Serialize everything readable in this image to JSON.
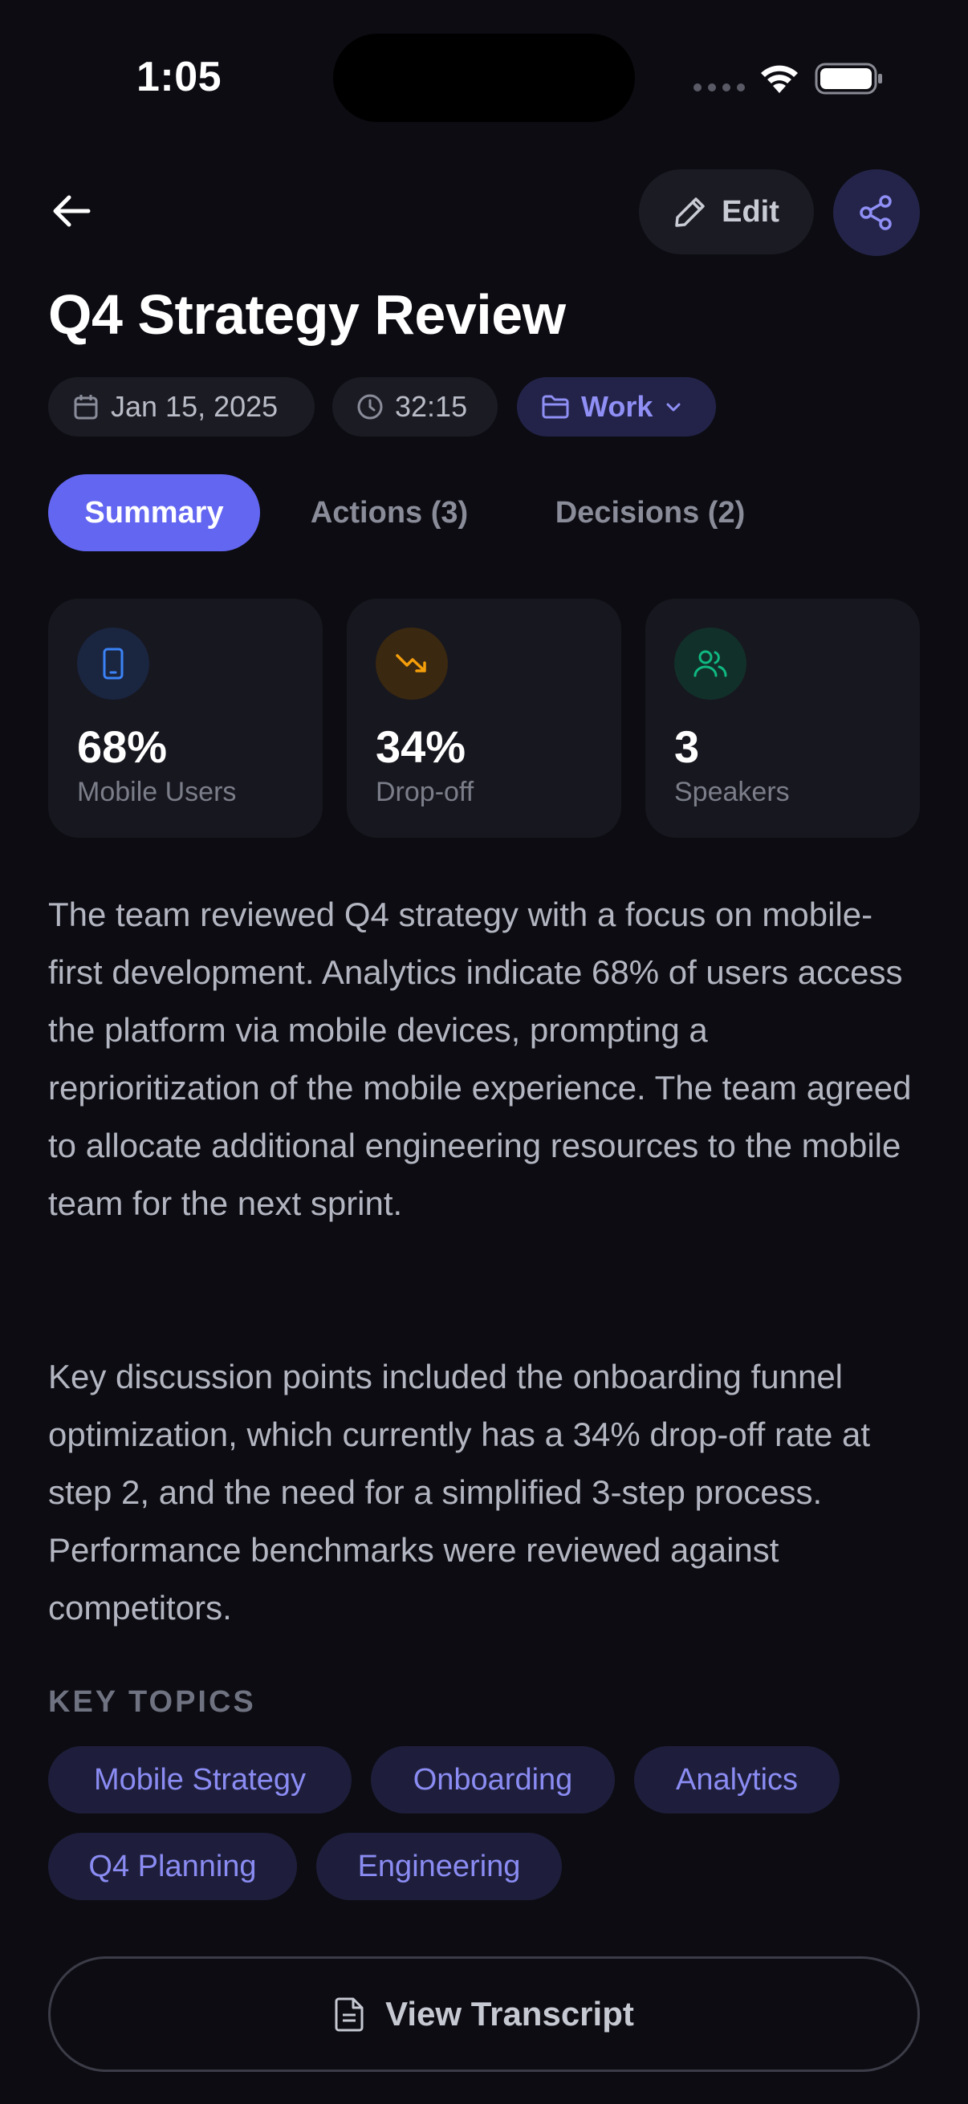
{
  "status_bar": {
    "time": "1:05"
  },
  "header": {
    "edit_label": "Edit"
  },
  "meeting": {
    "title": "Q4 Strategy Review",
    "date": "Jan 15, 2025",
    "duration": "32:15",
    "folder": "Work"
  },
  "tabs": [
    {
      "label": "Summary",
      "active": true
    },
    {
      "label": "Actions (3)",
      "active": false
    },
    {
      "label": "Decisions (2)",
      "active": false
    }
  ],
  "stats": [
    {
      "value": "68%",
      "label": "Mobile Users",
      "icon": "smartphone-icon",
      "color": "#3b82f6"
    },
    {
      "value": "34%",
      "label": "Drop-off",
      "icon": "trending-down-icon",
      "color": "#f59e0b"
    },
    {
      "value": "3",
      "label": "Speakers",
      "icon": "users-icon",
      "color": "#10b981"
    }
  ],
  "summary": {
    "paragraph1": "The team reviewed Q4 strategy with a focus on mobile-first development. Analytics indicate 68% of users access the platform via mobile devices, prompting a reprioritization of the mobile experience. The team agreed to allocate additional engineering resources to the mobile team for the next sprint.",
    "paragraph2": "Key discussion points included the onboarding funnel optimization, which currently has a 34% drop-off rate at step 2, and the need for a simplified 3-step process. Performance benchmarks were reviewed against competitors."
  },
  "key_topics": {
    "heading": "KEY TOPICS",
    "tags": [
      "Mobile Strategy",
      "Onboarding",
      "Analytics",
      "Q4 Planning",
      "Engineering"
    ]
  },
  "footer": {
    "view_transcript_label": "View Transcript"
  },
  "colors": {
    "accent": "#6366f1",
    "background": "#0c0c12"
  }
}
